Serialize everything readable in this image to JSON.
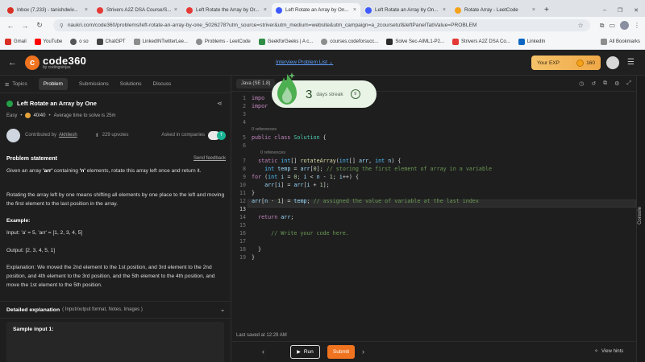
{
  "browser": {
    "tabs": [
      {
        "title": "Inbox (7,233) - tanishdwiv...",
        "color": "#d93025",
        "active": false
      },
      {
        "title": "Strivers A2Z DSA Course/S...",
        "color": "#e53935",
        "active": false
      },
      {
        "title": "Left Rotate the Array by Or...",
        "color": "#e53935",
        "active": false
      },
      {
        "title": "Left Rotate an Array by On...",
        "color": "#3d5afe",
        "active": true
      },
      {
        "title": "Left Rotate an Array by On...",
        "color": "#3d5afe",
        "active": false
      },
      {
        "title": "Rotate Array - LeetCode",
        "color": "#f4a21b",
        "active": false
      }
    ],
    "new_tab": "+",
    "url": "naukri.com/code360/problems/left-rotate-an-array-by-one_5026278?utm_source=striver&utm_medium=website&utm_campaign=a_zcoursetuf&leftPanelTabValue=PROBLEM",
    "bookmarks": [
      {
        "label": "Gmail",
        "color": "#d93025"
      },
      {
        "label": "YouTube",
        "color": "#ff0000"
      },
      {
        "label": "o so",
        "color": "#555555"
      },
      {
        "label": "ChatGPT",
        "color": "#444444"
      },
      {
        "label": "LinkedINTwitterLee...",
        "color": "#8d8d8d"
      },
      {
        "label": "Problems - LeetCode",
        "color": "#8d8d8d"
      },
      {
        "label": "GeekforGeeks | A c...",
        "color": "#2f8d46"
      },
      {
        "label": "courses.codeforsucc...",
        "color": "#8d8d8d"
      },
      {
        "label": "Solve Sec-AIML1-P2...",
        "color": "#2c2c2c"
      },
      {
        "label": "Strivers A2Z DSA Co...",
        "color": "#e53935"
      },
      {
        "label": "LinkedIn",
        "color": "#0a66c2"
      }
    ],
    "all_bookmarks": "All Bookmarks"
  },
  "app": {
    "logo_letter": "c",
    "logo_name": "code360",
    "logo_sub": "by codingninjas",
    "interview_list": "Interview Problem List",
    "exp_label": "Your EXP",
    "exp_value": "160"
  },
  "left": {
    "tabs": {
      "topics": "Topics",
      "problem": "Problem",
      "submissions": "Submissions",
      "solutions": "Solutions",
      "discuss": "Discuss"
    },
    "title": "Left Rotate an Array by One",
    "difficulty": "Easy",
    "score": "40/40",
    "avg_time": "Average time to solve is 25m",
    "contributed_by": "Contributed by",
    "contributor": "Akhilesh",
    "upvotes": "229 upvotes",
    "asked_in": "Asked in companies",
    "statement_header": "Problem statement",
    "send_feedback": "Send feedback",
    "para1_a": "Given an array ",
    "para1_b": "'arr'",
    "para1_c": " containing ",
    "para1_d": "'n'",
    "para1_e": " elements, rotate this array left once and return it.",
    "para2": "Rotating the array left by one means shifting all elements by one place to the left and moving the first element to the last position in the array.",
    "example_header": "Example:",
    "example_input": "Input: 'a' = 5, 'arr' = [1, 2, 3, 4, 5]",
    "example_output": "Output: [2, 3, 4, 5, 1]",
    "explanation": "Explanation: We moved the 2nd element to the 1st position, and 3rd element to the 2nd position, and 4th element to the 3rd position, and the 5th element to the 4th position, and move the 1st element to the 5th position.",
    "detailed": "Detailed explanation",
    "detailed_sub": "( Input/output format, Notes, Images )",
    "sample_input": "Sample input 1:"
  },
  "editor": {
    "language": "Java (SE 1.8)",
    "streak_count": "3",
    "streak_label": "days streak",
    "streak_badge": "9",
    "refs1": "0 references",
    "refs2": "0 references",
    "last_saved": "Last saved at 12:29 AM",
    "lines": [
      "1",
      "2",
      "3",
      "4",
      "5",
      "6",
      "7",
      "8",
      "9",
      "10",
      "11",
      "12",
      "13",
      "14",
      "15",
      "16",
      "17",
      "18",
      "19"
    ]
  },
  "bottom": {
    "run": "Run",
    "submit": "Submit",
    "hints": "View hints",
    "console": "Console"
  }
}
